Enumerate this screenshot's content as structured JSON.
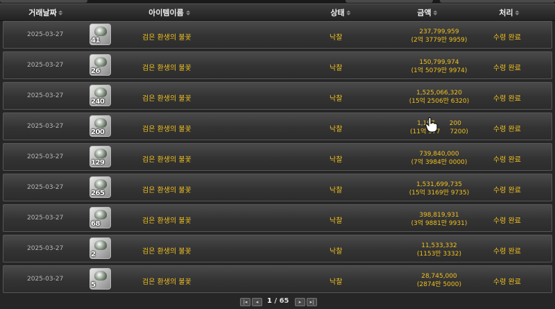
{
  "header": {
    "col_date": "거래날짜",
    "col_item": "아이템이름",
    "col_status": "상태",
    "col_amount": "금액",
    "col_result": "처리"
  },
  "rows": [
    {
      "date": "2025-03-27",
      "level": "41",
      "item": "검은 환생의 불꽃",
      "status": "낙찰",
      "amount": "237,799,959",
      "amount_kr": "(2억 3779만 9959)",
      "result": "수령 완료"
    },
    {
      "date": "2025-03-27",
      "level": "26",
      "item": "검은 환생의 불꽃",
      "status": "낙찰",
      "amount": "150,799,974",
      "amount_kr": "(1억 5079만 9974)",
      "result": "수령 완료"
    },
    {
      "date": "2025-03-27",
      "level": "240",
      "item": "검은 환생의 불꽃",
      "status": "낙찰",
      "amount": "1,525,066,320",
      "amount_kr": "(15억 2506만 6320)",
      "result": "수령 완료"
    },
    {
      "date": "2025-03-27",
      "level": "200",
      "item": "검은 환생의 불꽃",
      "status": "낙찰",
      "amount": "1,197,",
      "amount_b": "200",
      "amount_kr": "(11억 977",
      "amount_kr_b": "7200)",
      "result": "수령 완료"
    },
    {
      "date": "2025-03-27",
      "level": "129",
      "item": "검은 환생의 불꽃",
      "status": "낙찰",
      "amount": "739,840,000",
      "amount_kr": "(7억 3984만 0000)",
      "result": "수령 완료"
    },
    {
      "date": "2025-03-27",
      "level": "265",
      "item": "검은 환생의 불꽃",
      "status": "낙찰",
      "amount": "1,531,699,735",
      "amount_kr": "(15억 3169만 9735)",
      "result": "수령 완료"
    },
    {
      "date": "2025-03-27",
      "level": "68",
      "item": "검은 환생의 불꽃",
      "status": "낙찰",
      "amount": "398,819,931",
      "amount_kr": "(3억 9881만 9931)",
      "result": "수령 완료"
    },
    {
      "date": "2025-03-27",
      "level": "2",
      "item": "검은 환생의 불꽃",
      "status": "낙찰",
      "amount": "11,533,332",
      "amount_kr": "(1153만 3332)",
      "result": "수령 완료"
    },
    {
      "date": "2025-03-27",
      "level": "5",
      "item": "검은 환생의 불꽃",
      "status": "낙찰",
      "amount": "28,745,000",
      "amount_kr": "(2874만 5000)",
      "result": "수령 완료"
    }
  ],
  "pager": {
    "first_icon": "first-page-icon",
    "prev_icon": "prev-page-icon",
    "next_icon": "next-page-icon",
    "last_icon": "last-page-icon",
    "current": "1",
    "separator": "/",
    "total": "65"
  },
  "colors": {
    "accent": "#f0c020",
    "date_text": "#b8b8b8",
    "header_text": "#f0f0f0"
  }
}
